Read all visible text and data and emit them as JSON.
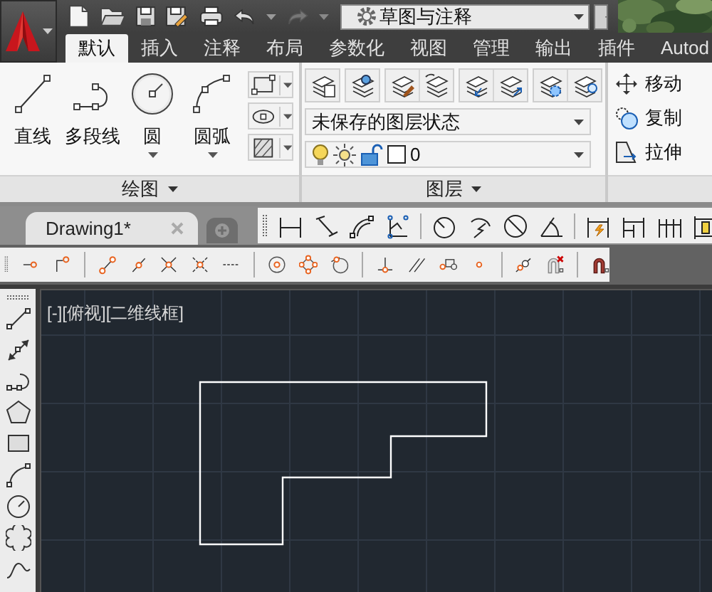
{
  "quick_access": {
    "workspace": "草图与注释"
  },
  "ribbon": {
    "tabs": [
      {
        "label": "默认",
        "selected": true
      },
      {
        "label": "插入",
        "selected": false
      },
      {
        "label": "注释",
        "selected": false
      },
      {
        "label": "布局",
        "selected": false
      },
      {
        "label": "参数化",
        "selected": false
      },
      {
        "label": "视图",
        "selected": false
      },
      {
        "label": "管理",
        "selected": false
      },
      {
        "label": "输出",
        "selected": false
      },
      {
        "label": "插件",
        "selected": false
      },
      {
        "label": "Autod",
        "selected": false
      }
    ],
    "draw_panel": {
      "title": "绘图",
      "tools": [
        "直线",
        "多段线",
        "圆",
        "圆弧"
      ]
    },
    "layers_panel": {
      "title": "图层",
      "layer_state": "未保存的图层状态",
      "current_layer": "0"
    },
    "modify_panel": {
      "tools": [
        "移动",
        "复制",
        "拉伸"
      ]
    }
  },
  "file_tabs": [
    {
      "label": "Drawing1*",
      "selected": true
    }
  ],
  "viewport": {
    "label": "[-][俯视][二维线框]"
  }
}
